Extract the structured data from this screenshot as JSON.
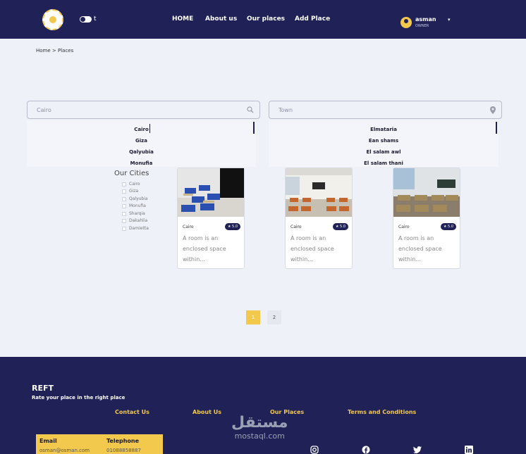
{
  "navbar": {
    "toggle_letter": "t",
    "links": [
      "HOME",
      "About us",
      "Our places",
      "Add Place"
    ],
    "user": {
      "name": "asman",
      "role": "OWNER",
      "caret": "▾"
    }
  },
  "breadcrumb": "Home > Places",
  "search": {
    "city_value": "Cairo",
    "town_placeholder": "Town",
    "city_options": [
      "Cairo",
      "Giza",
      "Qalyubia",
      "Monufia"
    ],
    "town_options": [
      "Elmataria",
      "Ean shams",
      "El salam awl",
      "El salam thani"
    ]
  },
  "filter": {
    "title": "Our Cities",
    "cities": [
      "Cairo",
      "Giza",
      "Qalyubia",
      "Monufia",
      "Sharqia",
      "Dakahlia",
      "Damietta"
    ]
  },
  "cards": [
    {
      "city": "Cairo",
      "rating": "★ 5.0",
      "description": "A room is an enclosed space within..."
    },
    {
      "city": "Cairo",
      "rating": "★ 5.0",
      "description": "A room is an enclosed space within..."
    },
    {
      "city": "Cairo",
      "rating": "★ 5.0",
      "description": "A room is an enclosed space within..."
    }
  ],
  "pagination": {
    "pages": [
      "1",
      "2"
    ],
    "current": 1
  },
  "footer": {
    "brand": "REFT",
    "tagline": "Rate your place in the right place",
    "links": [
      "Contact Us",
      "About Us",
      "Our Places",
      "Terms and Conditions"
    ],
    "contact": {
      "email_label": "Email",
      "email_value": "osman@osman.com",
      "phone_label": "Telephone",
      "phone_value": "01088858887"
    },
    "watermark_ar": "مستقل",
    "watermark_en": "mostaql.com",
    "social_icons": [
      "instagram-icon",
      "facebook-icon",
      "twitter-icon",
      "linkedin-icon"
    ]
  },
  "colors": {
    "primary": "#1f2157",
    "accent": "#f2c94c",
    "background": "#eef1f8"
  }
}
